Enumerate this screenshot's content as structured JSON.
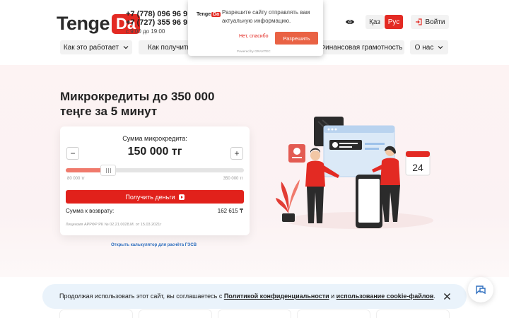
{
  "header": {
    "logo": {
      "part1": "Tenge",
      "part2": "Da"
    },
    "phones": [
      "+7 (778) 096 96 9",
      "+7 (727) 355 96 9"
    ],
    "hours": "с 9:00 до 19:00",
    "lang_kz": "Қаз",
    "lang_ru": "Рус",
    "login": "Войти",
    "nav": [
      {
        "label": "Как это работает"
      },
      {
        "label": "Как получить д"
      },
      {
        "label": "Финансовая грамотность"
      },
      {
        "label": "О нас"
      }
    ]
  },
  "popup": {
    "logo_part1": "Tenge",
    "logo_part2": "Da",
    "message": "Разрешите сайту отправлять вам актуальную информацию.",
    "decline": "Нет, спасибо",
    "allow": "Разрешить",
    "powered": "Powered by GRAVITEC"
  },
  "hero": {
    "title": "Микрокредиты до 350 000 теңге за 5 минут",
    "calculator": {
      "label": "Сумма микрокредита:",
      "amount": "150 000 тг",
      "minus": "−",
      "plus": "+",
      "slider_fraction": 0.24,
      "range_min": "80 000 тг",
      "range_max": "350 000 тг",
      "cta": "Получить деньги",
      "repay_label": "Сумма к возврату:",
      "repay_value": "162 615 ₸",
      "license": "Лицензия АРРФР РК № 02.21.0028.М. от 15.03.2021г"
    },
    "open_calculator": "Открыть калькулятор для расчёта ГЭСВ",
    "calendar_day": "24"
  },
  "cookie": {
    "text_before": "Продолжая использовать этот сайт, вы соглашаетесь с ",
    "privacy_link": "Политикой конфиденциальности",
    "text_middle": " и ",
    "cookie_link": "использование cookie-файлов",
    "text_after": "."
  },
  "colors": {
    "brand_red": "#e32a23",
    "cta_red": "#e1211b",
    "link_blue": "#2f6fbf",
    "cookie_bg": "#eaf3fb"
  },
  "icons": [
    "eye-icon",
    "login-icon",
    "chevron-down-icon",
    "close-icon",
    "chat-icon",
    "play-icon"
  ]
}
